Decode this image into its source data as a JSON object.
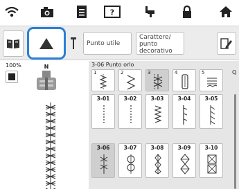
{
  "statusbar": {
    "icons": [
      "wifi-icon",
      "camera-icon",
      "document-icon",
      "help-icon",
      "thread-spool-icon",
      "lock-icon",
      "home-icon"
    ]
  },
  "toolbar": {
    "btn_embroidery_icon": "book-icon",
    "btn_presser_icon": "triangle-up-icon",
    "btn_needle_icon": "needle-icon",
    "useful_label": "Punto utile",
    "decorative_label": "Carattere/ punto decorativo",
    "edit_icon": "pencil-icon"
  },
  "left": {
    "zoom": "100%",
    "foot_code": "N"
  },
  "right": {
    "category_title": "3-06 Punto orlo",
    "top_tab_numbers": [
      "1",
      "2",
      "3",
      "4",
      "5"
    ],
    "q_label": "Q",
    "stitches": [
      {
        "code": "3-01"
      },
      {
        "code": "3-02"
      },
      {
        "code": "3-03"
      },
      {
        "code": "3-04"
      },
      {
        "code": "3-05"
      },
      {
        "code": "3-06"
      },
      {
        "code": "3-07"
      },
      {
        "code": "3-08"
      },
      {
        "code": "3-09"
      },
      {
        "code": "3-10"
      }
    ]
  },
  "colors": {
    "accent": "#2b7fd8",
    "selected_cell": "#cfcfcf",
    "panel": "#e6e6e6"
  }
}
